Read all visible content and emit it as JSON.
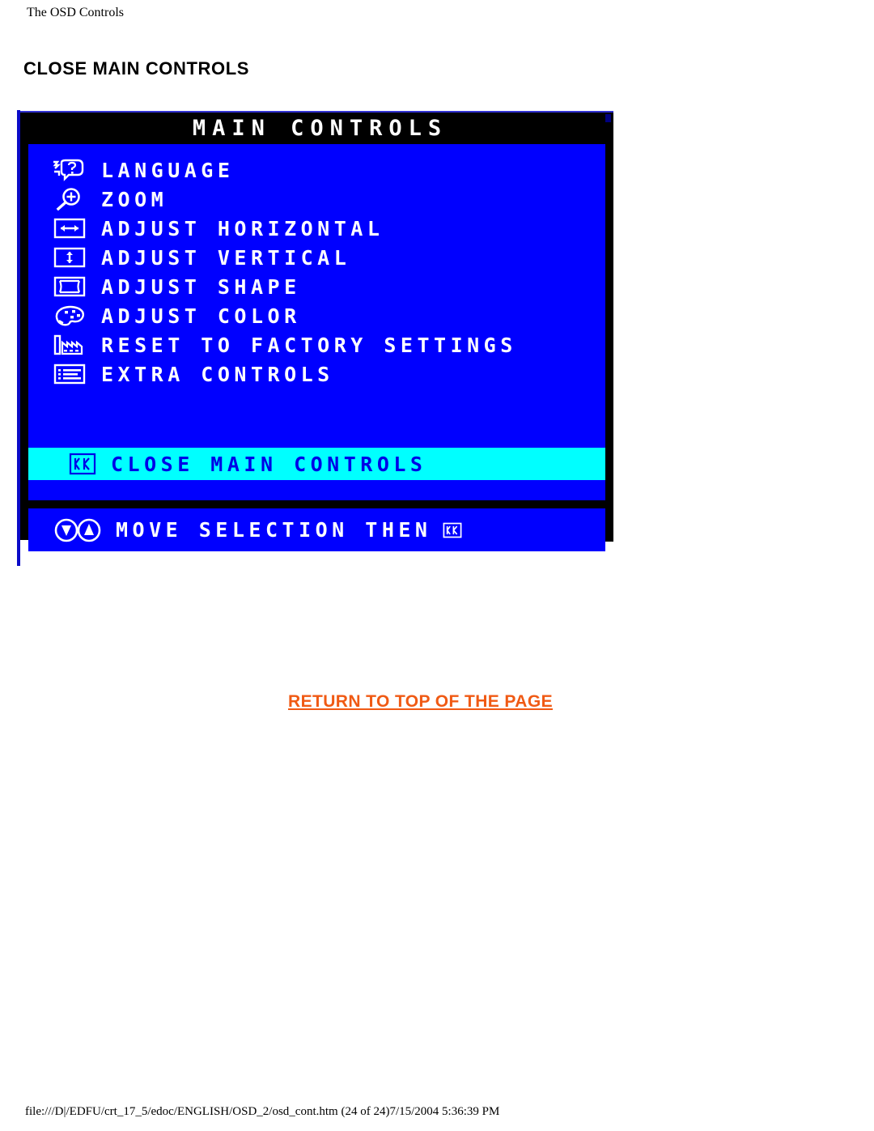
{
  "page": {
    "header": "The OSD Controls",
    "section_title": "CLOSE MAIN CONTROLS",
    "return_link": "RETURN TO TOP OF THE PAGE",
    "footer_path": "file:///D|/EDFU/crt_17_5/edoc/ENGLISH/OSD_2/osd_cont.htm (24 of 24)7/15/2004 5:36:39 PM"
  },
  "colors": {
    "osd_background": "#0000FF",
    "osd_frame": "#000000",
    "osd_text": "#FFFFFF",
    "osd_highlight_bg": "#00FFFF",
    "osd_highlight_text": "#0000E6",
    "link": "#F05A14",
    "page_bg": "#FFFFFF"
  },
  "osd": {
    "title": "MAIN CONTROLS",
    "menu_items": [
      {
        "icon": "speech-question-icon",
        "label": "LANGUAGE"
      },
      {
        "icon": "magnifier-plus-icon",
        "label": "ZOOM"
      },
      {
        "icon": "horizontal-arrows-icon",
        "label": "ADJUST HORIZONTAL"
      },
      {
        "icon": "vertical-arrows-icon",
        "label": "ADJUST VERTICAL"
      },
      {
        "icon": "pincushion-shape-icon",
        "label": "ADJUST SHAPE"
      },
      {
        "icon": "color-palette-icon",
        "label": "ADJUST COLOR"
      },
      {
        "icon": "factory-icon",
        "label": "RESET TO FACTORY SETTINGS"
      },
      {
        "icon": "list-lines-icon",
        "label": "EXTRA CONTROLS"
      }
    ],
    "selected_item": {
      "icon": "ok-button-icon",
      "label": "CLOSE MAIN CONTROLS"
    },
    "hint": {
      "arrows_icon": "up-down-arrow-buttons-icon",
      "text": "MOVE SELECTION THEN",
      "ok_icon": "ok-button-icon"
    }
  }
}
